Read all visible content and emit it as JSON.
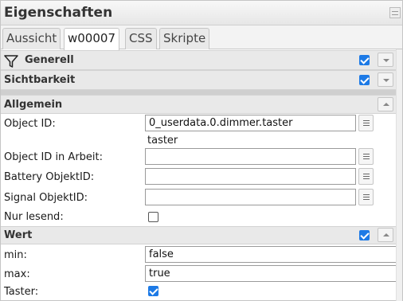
{
  "panel": {
    "title": "Eigenschaften"
  },
  "tabs": [
    {
      "label": "Aussicht",
      "active": false
    },
    {
      "label": "w00007",
      "active": true
    },
    {
      "label": "CSS",
      "active": false
    },
    {
      "label": "Skripte",
      "active": false
    }
  ],
  "sections": {
    "generell": {
      "label": "Generell",
      "checked": true,
      "icon": "filter-icon"
    },
    "sichtbarkeit": {
      "label": "Sichtbarkeit",
      "checked": true
    },
    "allgemein": {
      "label": "Allgemein"
    },
    "wert": {
      "label": "Wert",
      "checked": true
    }
  },
  "fields": {
    "object_id": {
      "label": "Object ID:",
      "value": "0_userdata.0.dimmer.taster",
      "hint": "taster"
    },
    "object_id_arbeit": {
      "label": "Object ID in Arbeit:",
      "value": ""
    },
    "battery_id": {
      "label": "Battery ObjektID:",
      "value": ""
    },
    "signal_id": {
      "label": "Signal ObjektID:",
      "value": ""
    },
    "nur_lesend": {
      "label": "Nur lesend:",
      "checked": false
    },
    "min": {
      "label": "min:",
      "value": "false"
    },
    "max": {
      "label": "max:",
      "value": "true"
    },
    "taster": {
      "label": "Taster:",
      "checked": true
    }
  },
  "colors": {
    "accent": "#1d7ae6",
    "section_bg": "#e9e9e9"
  }
}
